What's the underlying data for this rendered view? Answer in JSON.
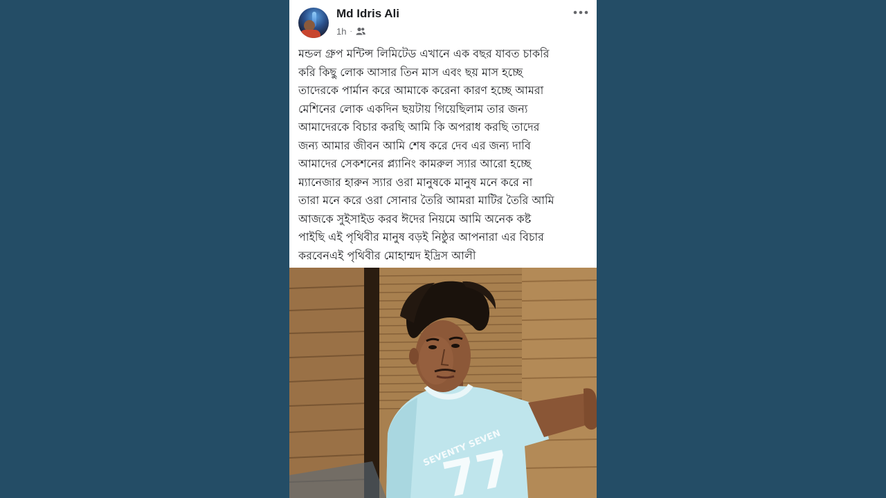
{
  "post": {
    "author": "Md Idris Ali",
    "time": "1h",
    "separator": "·",
    "audience_icon": "friends-icon",
    "more_icon": "more-horizontal-icon",
    "text": "মন্ডল গ্রুপ মন্টিন্স লিমিটেড এখানে এক বছর যাবত চাকরি\nকরি কিছু লোক আসার তিন মাস এবং ছয় মাস হচ্ছে\nতাদেরকে পার্মান করে আমাকে করেনা কারণ হচ্ছে আমরা\nমেশিনের লোক একদিন ছয়টায় গিয়েছিলাম তার জন্য\nআমাদেরকে বিচার করছি আমি কি অপরাধ করছি  তাদের\nজন্য আমার জীবন আমি শেষ করে দেব এর জন্য দাবি\nআমাদের সেকশনের প্ল্যানিং কামরুল স্যার  আরো হচ্ছে\nম্যানেজার হারুন স্যার ওরা মানুষকে মানুষ মনে করে না\nতারা মনে করে ওরা সোনার তৈরি আমরা মাটির তৈরি আমি\nআজকে সুইসাইড করব ঈদের নিয়মে আমি অনেক কষ্ট\nপাইছি এই পৃথিবীর মানুষ বড়ই নিষ্ঠুর  আপনারা এর বিচার\nকরবেনএই পৃথিবীর মোহাম্মদ ইদ্রিস  আলী",
    "photo": {
      "shirt_text": "SEVENTY SEVEN",
      "shirt_number": "77"
    }
  },
  "colors": {
    "background": "#244d66",
    "card": "#ffffff",
    "text": "#1c1e21",
    "secondary": "#65676b"
  }
}
